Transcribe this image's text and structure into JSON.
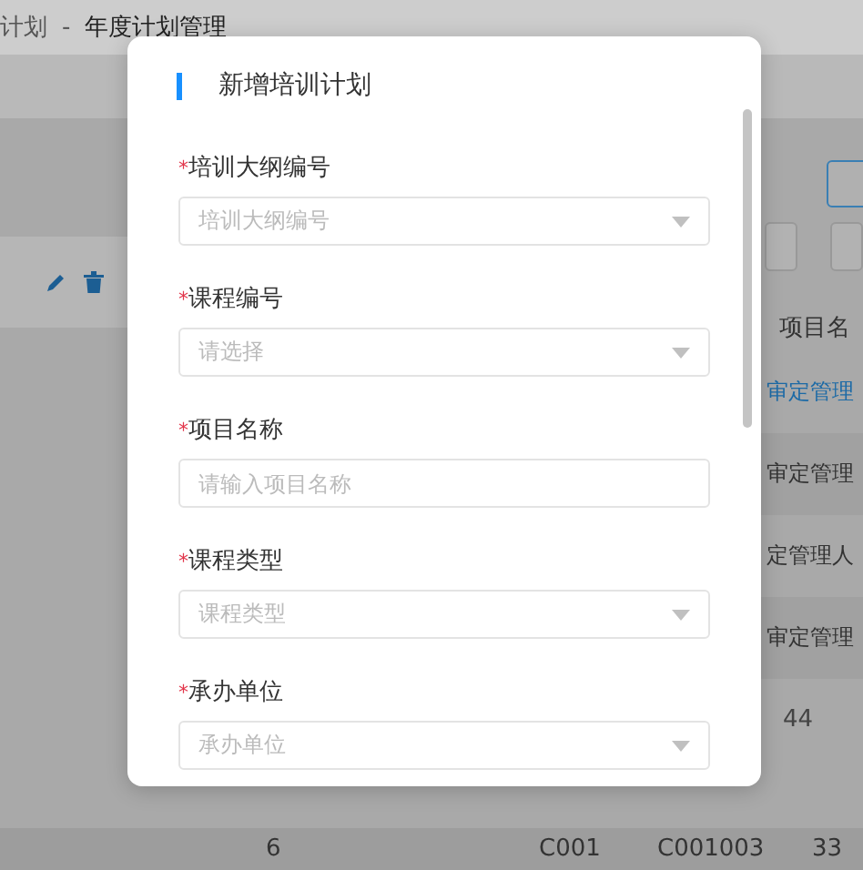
{
  "breadcrumb": {
    "items": [
      "计划",
      "年度计划管理"
    ],
    "separator": "-"
  },
  "table": {
    "column_header": "项目名",
    "cells": [
      {
        "text": "审定管理",
        "kind": "link"
      },
      {
        "text": "审定管理",
        "kind": "text"
      },
      {
        "text": "定管理人",
        "kind": "text"
      },
      {
        "text": "审定管理",
        "kind": "text"
      },
      {
        "text": "44",
        "kind": "number"
      }
    ],
    "bottom_row": [
      "6",
      "C001",
      "C001003",
      "33"
    ]
  },
  "modal": {
    "title": "新增培训计划",
    "required_mark": "*",
    "fields": [
      {
        "label": "培训大纲编号",
        "required": true,
        "kind": "select",
        "placeholder": "培训大纲编号"
      },
      {
        "label": "课程编号",
        "required": true,
        "kind": "select",
        "placeholder": "请选择"
      },
      {
        "label": "项目名称",
        "required": true,
        "kind": "input",
        "placeholder": "请输入项目名称"
      },
      {
        "label": "课程类型",
        "required": true,
        "kind": "select",
        "placeholder": "课程类型"
      },
      {
        "label": "承办单位",
        "required": true,
        "kind": "select",
        "placeholder": "承办单位"
      }
    ]
  }
}
